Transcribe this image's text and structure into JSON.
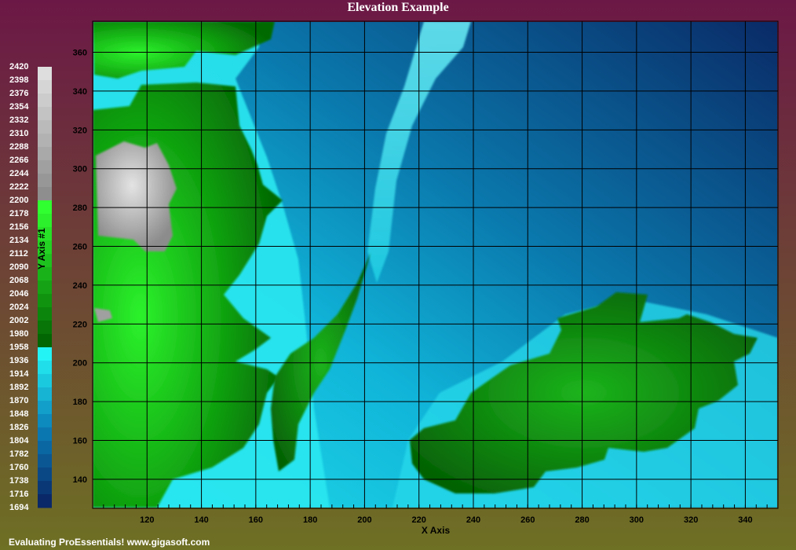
{
  "chart_data": {
    "type": "heatmap",
    "title": "Elevation Example",
    "xlabel": "X Axis",
    "ylabel": "Y Axis #1",
    "xlim": [
      100,
      352
    ],
    "ylim": [
      125,
      376
    ],
    "x_ticks": [
      120,
      140,
      160,
      180,
      200,
      220,
      240,
      260,
      280,
      300,
      320,
      340
    ],
    "y_ticks": [
      140,
      160,
      180,
      200,
      220,
      240,
      260,
      280,
      300,
      320,
      340,
      360
    ],
    "grid": true,
    "legend_placement": "left",
    "legend_levels": [
      2420,
      2398,
      2376,
      2354,
      2332,
      2310,
      2288,
      2266,
      2244,
      2222,
      2200,
      2178,
      2156,
      2134,
      2112,
      2090,
      2068,
      2046,
      2024,
      2002,
      1980,
      1958,
      1936,
      1914,
      1892,
      1870,
      1848,
      1826,
      1804,
      1782,
      1760,
      1738,
      1716,
      1694
    ],
    "colors": {
      "low": "#0a2060",
      "water_mid": "#0b7fb8",
      "water_high": "#22e8f0",
      "land_low": "#005e00",
      "land_high": "#2ef82e",
      "peak_low": "#8a8a8a",
      "peak_high": "#e2e2e2"
    }
  },
  "footer": "Evaluating ProEssentials! www.gigasoft.com",
  "colors": {
    "bg_top": "#6c1846",
    "bg_bottom": "#6e7024"
  }
}
